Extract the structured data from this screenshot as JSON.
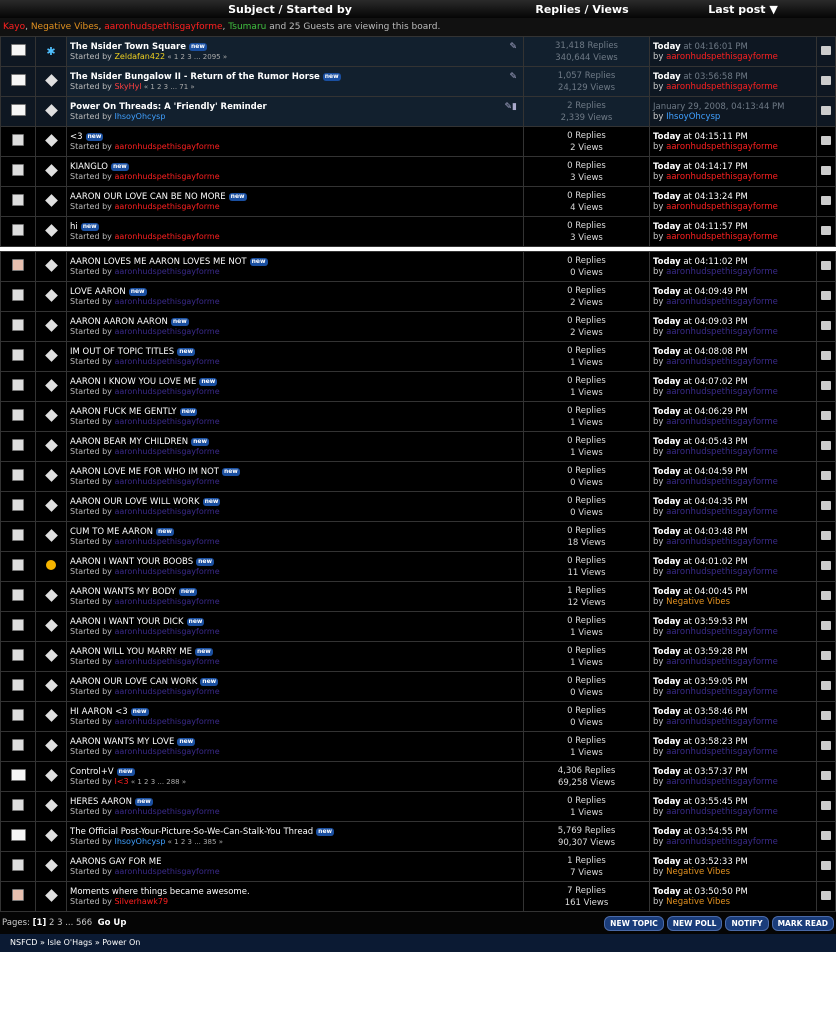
{
  "header": {
    "subject_col": "Subject / Started by",
    "replies_col": "Replies / Views",
    "lastpost_col": "Last post ▼"
  },
  "viewers": {
    "names": [
      {
        "name": "Kayo",
        "color": "#ff2020"
      },
      {
        "name": "Negative Vibes",
        "color": "#e09020"
      },
      {
        "name": "aaronhudspethisgayforme",
        "color": "#ff2020"
      },
      {
        "name": "Tsumaru",
        "color": "#40c040"
      }
    ],
    "suffix": "and 25 Guests are viewing this board."
  },
  "sticky_topics": [
    {
      "title": "The Nsider Town Square",
      "new": "new",
      "started_prefix": "Started by",
      "author": "Zeldafan422",
      "author_class": "cYel",
      "pages": "« 1 2 3 ... 2095 »",
      "replies": "31,418 Replies",
      "views": "340,644 Views",
      "lp_day": "Today",
      "lp_time": "at 04:16:01 PM",
      "lp_by": "by",
      "lp_author": "aaronhudspethisgayforme",
      "lp_class": "cRed",
      "icon": "hot",
      "mood": "bulb",
      "lock": "pin"
    },
    {
      "title": "The Nsider Bungalow II - Return of the Rumor Horse",
      "new": "new",
      "started_prefix": "Started by",
      "author": "SkyHyl",
      "author_class": "cPink",
      "pages": "« 1 2 3 ... 71 »",
      "replies": "1,057 Replies",
      "views": "24,129 Views",
      "lp_day": "Today",
      "lp_time": "at 03:56:58 PM",
      "lp_by": "by",
      "lp_author": "aaronhudspethisgayforme",
      "lp_class": "cRed",
      "icon": "hot",
      "mood": "diamond",
      "lock": "pin"
    },
    {
      "title": "Power On Threads: A 'Friendly' Reminder",
      "new": "",
      "started_prefix": "Started by",
      "author": "IhsoyOhcysp",
      "author_class": "cBlu",
      "pages": "",
      "replies": "2 Replies",
      "views": "2,339 Views",
      "lp_day": "",
      "lp_time": "January 29, 2008, 04:13:44 PM",
      "lp_by": "by",
      "lp_author": "IhsoyOhcysp",
      "lp_class": "cBlu",
      "icon": "hot",
      "mood": "diamond",
      "lock": "pin-lock"
    }
  ],
  "recent_topics": [
    {
      "title": "<3",
      "new": "new",
      "author": "aaronhudspethisgayforme",
      "author_class": "cRed",
      "replies": "0 Replies",
      "views": "2 Views",
      "lp_time": "at 04:15:11 PM",
      "lp_author": "aaronhudspethisgayforme",
      "lp_class": "cRed",
      "icon": "norm",
      "mood": "diamond"
    },
    {
      "title": "KIANGLO",
      "new": "new",
      "author": "aaronhudspethisgayforme",
      "author_class": "cRed",
      "replies": "0 Replies",
      "views": "3 Views",
      "lp_time": "at 04:14:17 PM",
      "lp_author": "aaronhudspethisgayforme",
      "lp_class": "cRed",
      "icon": "norm",
      "mood": "diamond"
    },
    {
      "title": "AARON OUR LOVE CAN BE NO MORE",
      "new": "new",
      "author": "aaronhudspethisgayforme",
      "author_class": "cRed",
      "replies": "0 Replies",
      "views": "4 Views",
      "lp_time": "at 04:13:24 PM",
      "lp_author": "aaronhudspethisgayforme",
      "lp_class": "cRed",
      "icon": "norm",
      "mood": "diamond"
    },
    {
      "title": "hi",
      "new": "new",
      "author": "aaronhudspethisgayforme",
      "author_class": "cRed",
      "replies": "0 Replies",
      "views": "3 Views",
      "lp_time": "at 04:11:57 PM",
      "lp_author": "aaronhudspethisgayforme",
      "lp_class": "cRed",
      "icon": "norm",
      "mood": "diamond"
    }
  ],
  "topics": [
    {
      "title": "AARON LOVES ME AARON LOVES ME NOT",
      "new": "new",
      "author": "aaronhudspethisgayforme",
      "author_class": "cPur",
      "pages": "",
      "replies": "0 Replies",
      "views": "0 Views",
      "lp_time": "at 04:11:02 PM",
      "lp_author": "aaronhudspethisgayforme",
      "lp_class": "cPur",
      "icon": "poll",
      "mood": "diamond"
    },
    {
      "title": "LOVE AARON",
      "new": "new",
      "author": "aaronhudspethisgayforme",
      "author_class": "cPur",
      "pages": "",
      "replies": "0 Replies",
      "views": "2 Views",
      "lp_time": "at 04:09:49 PM",
      "lp_author": "aaronhudspethisgayforme",
      "lp_class": "cPur",
      "icon": "norm",
      "mood": "diamond"
    },
    {
      "title": "AARON AARON AARON",
      "new": "new",
      "author": "aaronhudspethisgayforme",
      "author_class": "cPur",
      "pages": "",
      "replies": "0 Replies",
      "views": "2 Views",
      "lp_time": "at 04:09:03 PM",
      "lp_author": "aaronhudspethisgayforme",
      "lp_class": "cPur",
      "icon": "norm",
      "mood": "diamond"
    },
    {
      "title": "IM OUT OF TOPIC TITLES",
      "new": "new",
      "author": "aaronhudspethisgayforme",
      "author_class": "cPur",
      "pages": "",
      "replies": "0 Replies",
      "views": "1 Views",
      "lp_time": "at 04:08:08 PM",
      "lp_author": "aaronhudspethisgayforme",
      "lp_class": "cPur",
      "icon": "norm",
      "mood": "diamond"
    },
    {
      "title": "AARON I KNOW YOU LOVE ME",
      "new": "new",
      "author": "aaronhudspethisgayforme",
      "author_class": "cPur",
      "pages": "",
      "replies": "0 Replies",
      "views": "1 Views",
      "lp_time": "at 04:07:02 PM",
      "lp_author": "aaronhudspethisgayforme",
      "lp_class": "cPur",
      "icon": "norm",
      "mood": "diamond"
    },
    {
      "title": "AARON FUCK ME GENTLY",
      "new": "new",
      "author": "aaronhudspethisgayforme",
      "author_class": "cPur",
      "pages": "",
      "replies": "0 Replies",
      "views": "1 Views",
      "lp_time": "at 04:06:29 PM",
      "lp_author": "aaronhudspethisgayforme",
      "lp_class": "cPur",
      "icon": "norm",
      "mood": "diamond"
    },
    {
      "title": "AARON BEAR MY CHILDREN",
      "new": "new",
      "author": "aaronhudspethisgayforme",
      "author_class": "cPur",
      "pages": "",
      "replies": "0 Replies",
      "views": "1 Views",
      "lp_time": "at 04:05:43 PM",
      "lp_author": "aaronhudspethisgayforme",
      "lp_class": "cPur",
      "icon": "norm",
      "mood": "diamond"
    },
    {
      "title": "AARON LOVE ME FOR WHO IM NOT",
      "new": "new",
      "author": "aaronhudspethisgayforme",
      "author_class": "cPur",
      "pages": "",
      "replies": "0 Replies",
      "views": "0 Views",
      "lp_time": "at 04:04:59 PM",
      "lp_author": "aaronhudspethisgayforme",
      "lp_class": "cPur",
      "icon": "norm",
      "mood": "diamond"
    },
    {
      "title": "AARON OUR LOVE WILL WORK",
      "new": "new",
      "author": "aaronhudspethisgayforme",
      "author_class": "cPur",
      "pages": "",
      "replies": "0 Replies",
      "views": "0 Views",
      "lp_time": "at 04:04:35 PM",
      "lp_author": "aaronhudspethisgayforme",
      "lp_class": "cPur",
      "icon": "norm",
      "mood": "diamond"
    },
    {
      "title": "CUM TO ME AARON",
      "new": "new",
      "author": "aaronhudspethisgayforme",
      "author_class": "cPur",
      "pages": "",
      "replies": "0 Replies",
      "views": "18 Views",
      "lp_time": "at 04:03:48 PM",
      "lp_author": "aaronhudspethisgayforme",
      "lp_class": "cPur",
      "icon": "norm",
      "mood": "diamond"
    },
    {
      "title": "AARON I WANT YOUR BOOBS",
      "new": "new",
      "author": "aaronhudspethisgayforme",
      "author_class": "cPur",
      "pages": "",
      "replies": "0 Replies",
      "views": "11 Views",
      "lp_time": "at 04:01:02 PM",
      "lp_author": "aaronhudspethisgayforme",
      "lp_class": "cPur",
      "icon": "norm",
      "mood": "smile"
    },
    {
      "title": "AARON WANTS MY BODY",
      "new": "new",
      "author": "aaronhudspethisgayforme",
      "author_class": "cPur",
      "pages": "",
      "replies": "1 Replies",
      "views": "12 Views",
      "lp_time": "at 04:00:45 PM",
      "lp_author": "Negative Vibes",
      "lp_class": "cOr",
      "icon": "norm",
      "mood": "diamond"
    },
    {
      "title": "AARON I WANT YOUR DICK",
      "new": "new",
      "author": "aaronhudspethisgayforme",
      "author_class": "cPur",
      "pages": "",
      "replies": "0 Replies",
      "views": "1 Views",
      "lp_time": "at 03:59:53 PM",
      "lp_author": "aaronhudspethisgayforme",
      "lp_class": "cPur",
      "icon": "norm",
      "mood": "diamond"
    },
    {
      "title": "AARON WILL YOU MARRY ME",
      "new": "new",
      "author": "aaronhudspethisgayforme",
      "author_class": "cPur",
      "pages": "",
      "replies": "0 Replies",
      "views": "1 Views",
      "lp_time": "at 03:59:28 PM",
      "lp_author": "aaronhudspethisgayforme",
      "lp_class": "cPur",
      "icon": "norm",
      "mood": "diamond"
    },
    {
      "title": "AARON OUR LOVE CAN WORK",
      "new": "new",
      "author": "aaronhudspethisgayforme",
      "author_class": "cPur",
      "pages": "",
      "replies": "0 Replies",
      "views": "0 Views",
      "lp_time": "at 03:59:05 PM",
      "lp_author": "aaronhudspethisgayforme",
      "lp_class": "cPur",
      "icon": "norm",
      "mood": "diamond"
    },
    {
      "title": "HI AARON <3",
      "new": "new",
      "author": "aaronhudspethisgayforme",
      "author_class": "cPur",
      "pages": "",
      "replies": "0 Replies",
      "views": "0 Views",
      "lp_time": "at 03:58:46 PM",
      "lp_author": "aaronhudspethisgayforme",
      "lp_class": "cPur",
      "icon": "norm",
      "mood": "diamond"
    },
    {
      "title": "AARON WANTS MY LOVE",
      "new": "new",
      "author": "aaronhudspethisgayforme",
      "author_class": "cPur",
      "pages": "",
      "replies": "0 Replies",
      "views": "1 Views",
      "lp_time": "at 03:58:23 PM",
      "lp_author": "aaronhudspethisgayforme",
      "lp_class": "cPur",
      "icon": "norm",
      "mood": "diamond"
    },
    {
      "title": "Control+V",
      "new": "new",
      "author": "I<3",
      "author_class": "cRed",
      "pages": "« 1 2 3 ... 288 »",
      "replies": "4,306 Replies",
      "views": "69,258 Views",
      "lp_time": "at 03:57:37 PM",
      "lp_author": "aaronhudspethisgayforme",
      "lp_class": "cPur",
      "icon": "hot",
      "mood": "diamond"
    },
    {
      "title": "HERES AARON",
      "new": "new",
      "author": "aaronhudspethisgayforme",
      "author_class": "cPur",
      "pages": "",
      "replies": "0 Replies",
      "views": "1 Views",
      "lp_time": "at 03:55:45 PM",
      "lp_author": "aaronhudspethisgayforme",
      "lp_class": "cPur",
      "icon": "norm",
      "mood": "diamond"
    },
    {
      "title": "The Official Post-Your-Picture-So-We-Can-Stalk-You Thread",
      "new": "new",
      "author": "IhsoyOhcysp",
      "author_class": "cBlu",
      "pages": "« 1 2 3 ... 385 »",
      "replies": "5,769 Replies",
      "views": "90,307 Views",
      "lp_time": "at 03:54:55 PM",
      "lp_author": "aaronhudspethisgayforme",
      "lp_class": "cPur",
      "icon": "hot",
      "mood": "diamond"
    },
    {
      "title": "AARONS GAY FOR ME",
      "new": "",
      "author": "aaronhudspethisgayforme",
      "author_class": "cPur",
      "pages": "",
      "replies": "1 Replies",
      "views": "7 Views",
      "lp_time": "at 03:52:33 PM",
      "lp_author": "Negative Vibes",
      "lp_class": "cOr",
      "icon": "norm",
      "mood": "diamond"
    },
    {
      "title": "Moments where things became awesome.",
      "new": "",
      "author": "Silverhawk79",
      "author_class": "cRed",
      "pages": "",
      "replies": "7 Replies",
      "views": "161 Views",
      "lp_time": "at 03:50:50 PM",
      "lp_author": "Negative Vibes",
      "lp_class": "cOr",
      "icon": "poll",
      "mood": "diamond"
    }
  ],
  "labels": {
    "started_by": "Started by",
    "today": "Today",
    "by": "by"
  },
  "footer": {
    "pages_label": "Pages:",
    "current_page": "[1]",
    "other_pages": "2 3 ... 566",
    "go_up": "Go Up",
    "buttons": [
      "NEW TOPIC",
      "NEW POLL",
      "NOTIFY",
      "MARK READ"
    ]
  },
  "breadcrumb": [
    "NSFCD",
    "Isle O'Hags",
    "Power On"
  ],
  "colors": {
    "background": "#000000",
    "sticky_bg": "#0e1722",
    "button": "#1a3c7a",
    "breadcrumb_bar": "#0b1a33"
  }
}
